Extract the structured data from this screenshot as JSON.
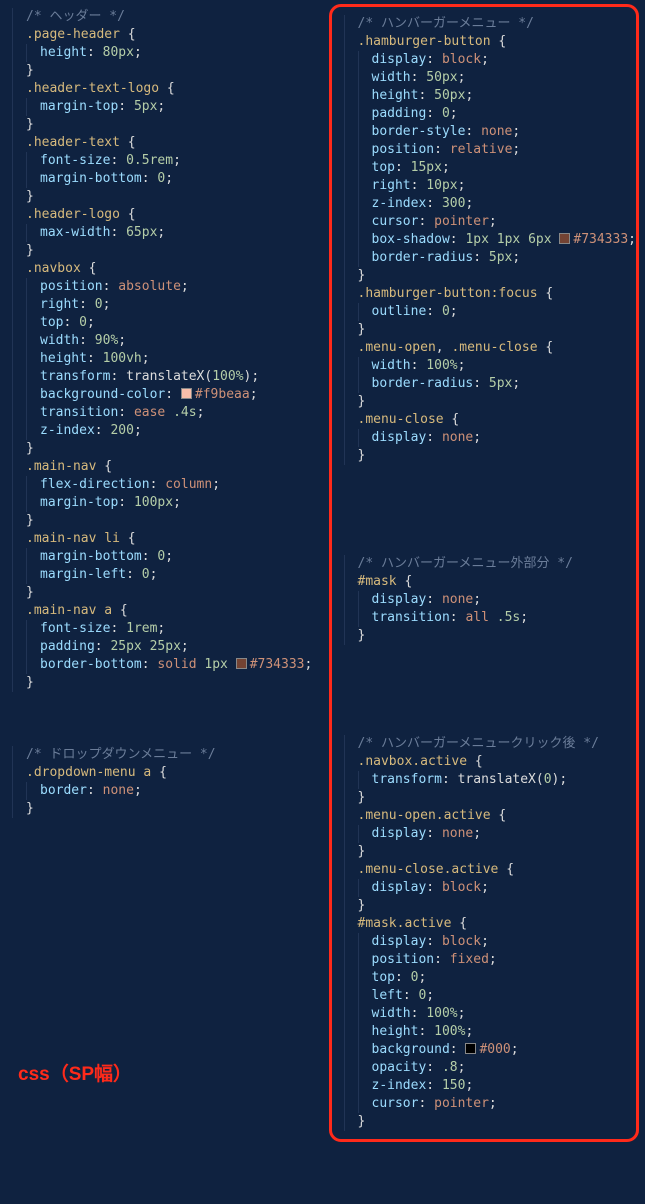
{
  "caption": "css（SP幅）",
  "left": {
    "groups": [
      {
        "comment": "/* ヘッダー */",
        "rules": [
          {
            "selector": ".page-header",
            "decls": [
              [
                "height",
                "80px"
              ]
            ]
          },
          {
            "selector": ".header-text-logo",
            "decls": [
              [
                "margin-top",
                "5px"
              ]
            ]
          },
          {
            "selector": ".header-text",
            "decls": [
              [
                "font-size",
                "0.5rem"
              ],
              [
                "margin-bottom",
                "0"
              ]
            ]
          },
          {
            "selector": ".header-logo",
            "decls": [
              [
                "max-width",
                "65px"
              ]
            ]
          },
          {
            "selector": ".navbox",
            "decls": [
              [
                "position",
                "absolute"
              ],
              [
                "right",
                "0"
              ],
              [
                "top",
                "0"
              ],
              [
                "width",
                "90%"
              ],
              [
                "height",
                "100vh"
              ],
              [
                "transform",
                "translateX(100%)"
              ],
              [
                "background-color",
                "#f9beaa"
              ],
              [
                "transition",
                "ease .4s"
              ],
              [
                "z-index",
                "200"
              ]
            ]
          },
          {
            "selector": ".main-nav",
            "decls": [
              [
                "flex-direction",
                "column"
              ],
              [
                "margin-top",
                "100px"
              ]
            ]
          },
          {
            "selector": ".main-nav li",
            "decls": [
              [
                "margin-bottom",
                "0"
              ],
              [
                "margin-left",
                "0"
              ]
            ]
          },
          {
            "selector": ".main-nav a",
            "decls": [
              [
                "font-size",
                "1rem"
              ],
              [
                "padding",
                "25px 25px"
              ],
              [
                "border-bottom",
                "solid 1px #734333"
              ]
            ]
          }
        ],
        "gapAfter": 3
      },
      {
        "comment": "/* ドロップダウンメニュー */",
        "rules": [
          {
            "selector": ".dropdown-menu a",
            "decls": [
              [
                "border",
                "none"
              ]
            ]
          }
        ],
        "gapAfter": 0
      }
    ]
  },
  "right": {
    "groups": [
      {
        "comment": "/* ハンバーガーメニュー */",
        "rules": [
          {
            "selector": ".hamburger-button",
            "decls": [
              [
                "display",
                "block"
              ],
              [
                "width",
                "50px"
              ],
              [
                "height",
                "50px"
              ],
              [
                "padding",
                "0"
              ],
              [
                "border-style",
                "none"
              ],
              [
                "position",
                "relative"
              ],
              [
                "top",
                "15px"
              ],
              [
                "right",
                "10px"
              ],
              [
                "z-index",
                "300"
              ],
              [
                "cursor",
                "pointer"
              ],
              [
                "box-shadow",
                "1px 1px 6px #734333"
              ],
              [
                "border-radius",
                "5px"
              ]
            ]
          },
          {
            "selector": ".hamburger-button:focus",
            "decls": [
              [
                "outline",
                "0"
              ]
            ]
          },
          {
            "selector": ".menu-open, .menu-close",
            "decls": [
              [
                "width",
                "100%"
              ],
              [
                "border-radius",
                "5px"
              ]
            ]
          },
          {
            "selector": ".menu-close",
            "decls": [
              [
                "display",
                "none"
              ]
            ]
          }
        ],
        "gapAfter": 5
      },
      {
        "comment": "/* ハンバーガーメニュー外部分 */",
        "rules": [
          {
            "selector": "#mask",
            "decls": [
              [
                "display",
                "none"
              ],
              [
                "transition",
                "all .5s"
              ]
            ]
          }
        ],
        "gapAfter": 5
      },
      {
        "comment": "/* ハンバーガーメニュークリック後 */",
        "rules": [
          {
            "selector": ".navbox.active",
            "decls": [
              [
                "transform",
                "translateX(0)"
              ]
            ]
          },
          {
            "selector": ".menu-open.active",
            "decls": [
              [
                "display",
                "none"
              ]
            ]
          },
          {
            "selector": ".menu-close.active",
            "decls": [
              [
                "display",
                "block"
              ]
            ]
          },
          {
            "selector": "#mask.active",
            "decls": [
              [
                "display",
                "block"
              ],
              [
                "position",
                "fixed"
              ],
              [
                "top",
                "0"
              ],
              [
                "left",
                "0"
              ],
              [
                "width",
                "100%"
              ],
              [
                "height",
                "100%"
              ],
              [
                "background",
                "#000"
              ],
              [
                "opacity",
                ".8"
              ],
              [
                "z-index",
                "150"
              ],
              [
                "cursor",
                "pointer"
              ]
            ]
          }
        ],
        "gapAfter": 0
      }
    ]
  }
}
